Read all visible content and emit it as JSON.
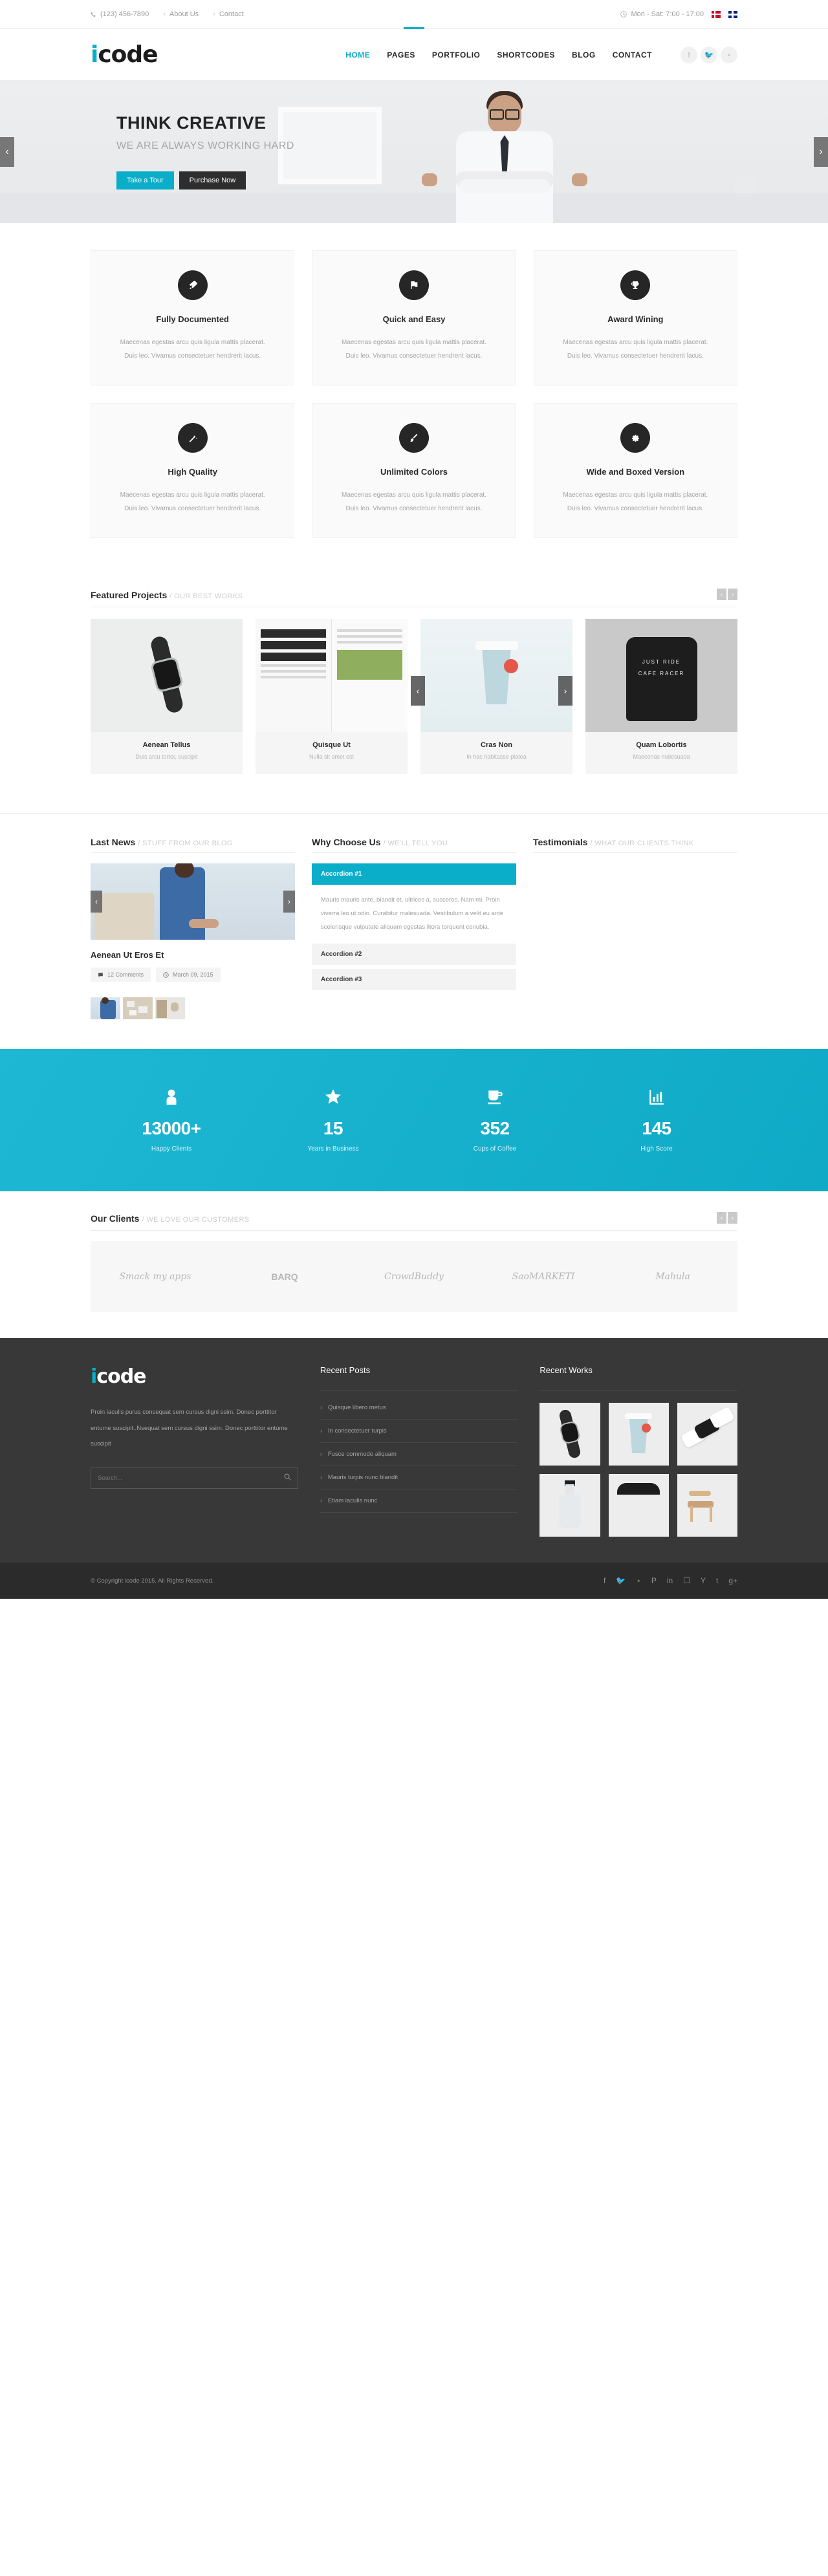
{
  "topbar": {
    "phone": "(123) 456-7890",
    "links": [
      "About Us",
      "Contact"
    ],
    "hours": "Mon - Sat: 7:00 - 17:00",
    "phone_icon": "phone-icon",
    "clock_icon": "clock-icon",
    "flags": [
      "flag-denmark",
      "flag-uk"
    ]
  },
  "header": {
    "logo_i": "i",
    "logo_rest": "code",
    "nav": [
      "HOME",
      "PAGES",
      "PORTFOLIO",
      "SHORTCODES",
      "BLOG",
      "CONTACT"
    ],
    "active_nav": "HOME",
    "social": [
      "facebook-icon",
      "twitter-icon",
      "rss-icon"
    ],
    "social_glyphs": [
      "f",
      "t",
      "r"
    ]
  },
  "hero": {
    "title": "THINK CREATIVE",
    "subtitle": "WE ARE ALWAYS WORKING HARD",
    "btn_primary": "Take a Tour",
    "btn_secondary": "Purchase Now",
    "prev": "‹",
    "next": "›",
    "accent": "#0aaec9"
  },
  "features": [
    {
      "icon": "rocket-icon",
      "glyph": "✈",
      "title": "Fully Documented",
      "line1": "Maecenas egestas arcu quis ligula mattis placerat.",
      "line2": "Duis leo. Vivamus consectetuer hendrerit lacus."
    },
    {
      "icon": "flag-icon",
      "glyph": "⚑",
      "title": "Quick and Easy",
      "line1": "Maecenas egestas arcu quis ligula mattis placerat.",
      "line2": "Duis leo. Vivamus consectetuer hendrerit lacus."
    },
    {
      "icon": "trophy-icon",
      "glyph": "♜",
      "title": "Award Wining",
      "line1": "Maecenas egestas arcu quis ligula mattis placerat.",
      "line2": "Duis leo. Vivamus consectetuer hendrerit lacus."
    },
    {
      "icon": "magic-wand-icon",
      "glyph": "✦",
      "title": "High Quality",
      "line1": "Maecenas egestas arcu quis ligula mattis placerat.",
      "line2": "Duis leo. Vivamus consectetuer hendrerit lacus."
    },
    {
      "icon": "paintbrush-icon",
      "glyph": "✎",
      "title": "Unlimited Colors",
      "line1": "Maecenas egestas arcu quis ligula mattis placerat.",
      "line2": "Duis leo. Vivamus consectetuer hendrerit lacus."
    },
    {
      "icon": "gear-icon",
      "glyph": "⚙",
      "title": "Wide and Boxed Version",
      "line1": "Maecenas egestas arcu quis ligula mattis placerat.",
      "line2": "Duis leo. Vivamus consectetuer hendrerit lacus."
    }
  ],
  "portfolio": {
    "title": "Featured Projects",
    "subtitle": "/ OUR BEST WORKS",
    "prev": "‹",
    "next": "›",
    "slide_prev": "‹",
    "slide_next": "›",
    "items": [
      {
        "title": "Aenean Tellus",
        "desc": "Duis arcu tortor, suscipit",
        "art": "smartwatch"
      },
      {
        "title": "Quisque Ut",
        "desc": "Nulla sit amet est",
        "art": "magazine"
      },
      {
        "title": "Cras Non",
        "desc": "In hac habitasse platea",
        "art": "papercup"
      },
      {
        "title": "Quam Lobortis",
        "desc": "Maecenas malesuada",
        "art": "hoodie"
      }
    ]
  },
  "news": {
    "title": "Last News",
    "subtitle": "/ STUFF FROM OUR BLOG",
    "prev": "‹",
    "next": "›",
    "post_title": "Aenean Ut Eros Et",
    "comments": "12 Comments",
    "date": "March 09, 2015",
    "comment_icon": "comment-icon",
    "clock_icon": "clock-icon"
  },
  "why": {
    "title": "Why Choose Us",
    "subtitle": "/ WE'LL TELL YOU",
    "accordions": [
      {
        "label": "Accordion #1",
        "open": true,
        "body": "Mauris mauris ante, blandit et, ultrices a, susceros. Nam mi. Proin viverra leo ut odio. Curabitur malesuada. Vestibulum a velit eu ante scelerisque vulputate aliquam egestas litora torquent conubia."
      },
      {
        "label": "Accordion #2",
        "open": false,
        "body": ""
      },
      {
        "label": "Accordion #3",
        "open": false,
        "body": ""
      }
    ]
  },
  "testimonials": {
    "title": "Testimonials",
    "subtitle": "/ WHAT OUR CLIENTS THINK"
  },
  "counters": [
    {
      "icon": "user-icon",
      "glyph": "👤",
      "number": "13000+",
      "label": "Happy Clients"
    },
    {
      "icon": "star-icon",
      "glyph": "★",
      "number": "15",
      "label": "Years in Business"
    },
    {
      "icon": "coffee-icon",
      "glyph": "☕",
      "number": "352",
      "label": "Cups of Coffee"
    },
    {
      "icon": "bar-chart-icon",
      "glyph": "📊",
      "number": "145",
      "label": "High Score"
    }
  ],
  "counters_bg": "#10b3d1",
  "clients": {
    "title": "Our Clients",
    "subtitle": "/ WE LOVE OUR CUSTOMERS",
    "prev": "‹",
    "next": "›",
    "logos": [
      "Smack my apps",
      "BARQ",
      "CrowdBuddy",
      "SaoMARKETI",
      "Mahula"
    ]
  },
  "footer": {
    "logo_i": "i",
    "logo_rest": "code",
    "about": "Proin iaculis purus consequat sem cursus digni ssim. Donec porttitor entume suscipit..Nsequat sem cursus digni ssim. Donec porttitor entume suscipit",
    "search_placeholder": "Search...",
    "search_value": "",
    "search_icon": "search-icon",
    "recent_posts_title": "Recent Posts",
    "recent_posts": [
      "Quisque libero metus",
      "In consectetuer turpis",
      "Fusce commodo aliquam",
      "Mauris turpis nunc blandit",
      "Etiam iaculis nunc"
    ],
    "recent_works_title": "Recent Works",
    "works": [
      "smartwatch",
      "papercup",
      "phones",
      "bottle",
      "hoodie",
      "chair"
    ]
  },
  "copyright": {
    "text": "© Copyright icode 2015. All Rights Reserved.",
    "social": [
      "facebook-icon",
      "twitter-icon",
      "rss-icon",
      "pinterest-icon",
      "linkedin-icon",
      "instagram-icon",
      "yahoo-icon",
      "tumblr-icon",
      "google-plus-icon"
    ],
    "glyphs": [
      "f",
      "t",
      "r",
      "P",
      "in",
      "ig",
      "Y",
      "t",
      "g+"
    ]
  }
}
